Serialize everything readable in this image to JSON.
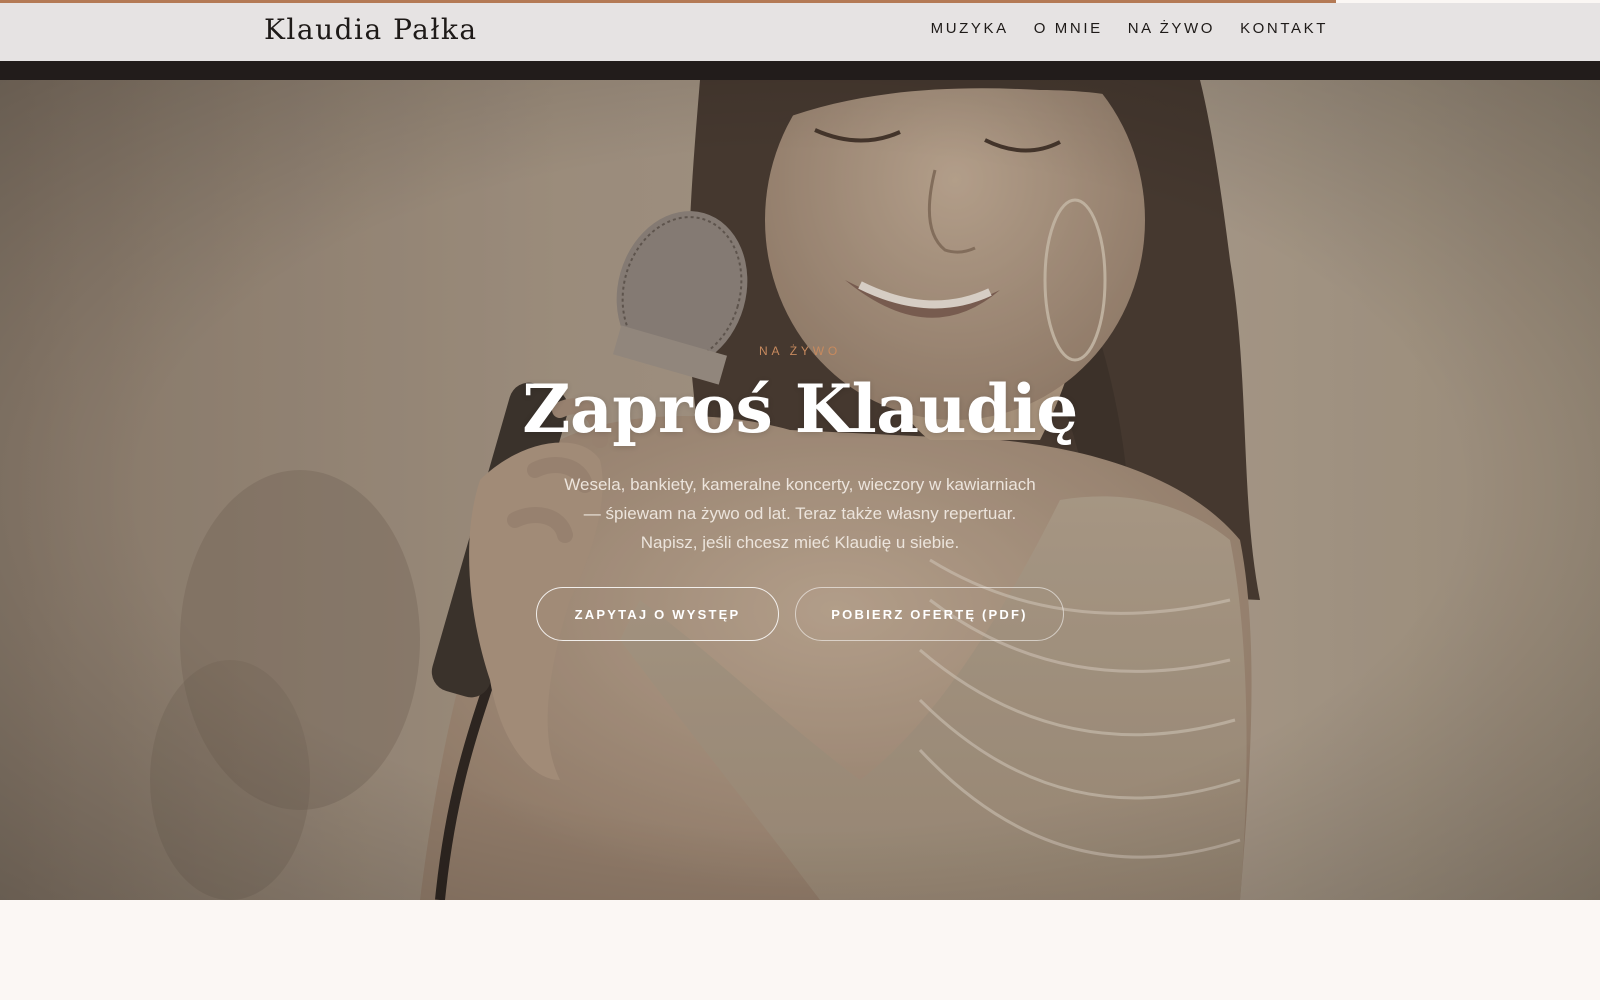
{
  "site": {
    "logo": "Klaudia Pałka"
  },
  "nav": {
    "items": [
      {
        "label": "MUZYKA"
      },
      {
        "label": "O MNIE"
      },
      {
        "label": "NA ŻYWO"
      },
      {
        "label": "KONTAKT"
      }
    ]
  },
  "hero": {
    "eyebrow": "NA ŻYWO",
    "title": "Zaproś Klaudię",
    "description_lines": [
      "Wesela, bankiety, kameralne koncerty, wieczory w kawiarniach",
      "— śpiewam na żywo od lat. Teraz także własny repertuar.",
      "Napisz, jeśli chcesz mieć Klaudię u siebie."
    ],
    "buttons": {
      "primary": "ZAPYTAJ O WYSTĘP",
      "secondary": "POBIERZ OFERTĘ (PDF)"
    }
  },
  "colors": {
    "accent": "#b47a55",
    "eyebrow": "#c88a5e",
    "header_bg": "#e6e3e3",
    "dark_band": "#221c1b",
    "page_bg": "#fbf7f4"
  }
}
